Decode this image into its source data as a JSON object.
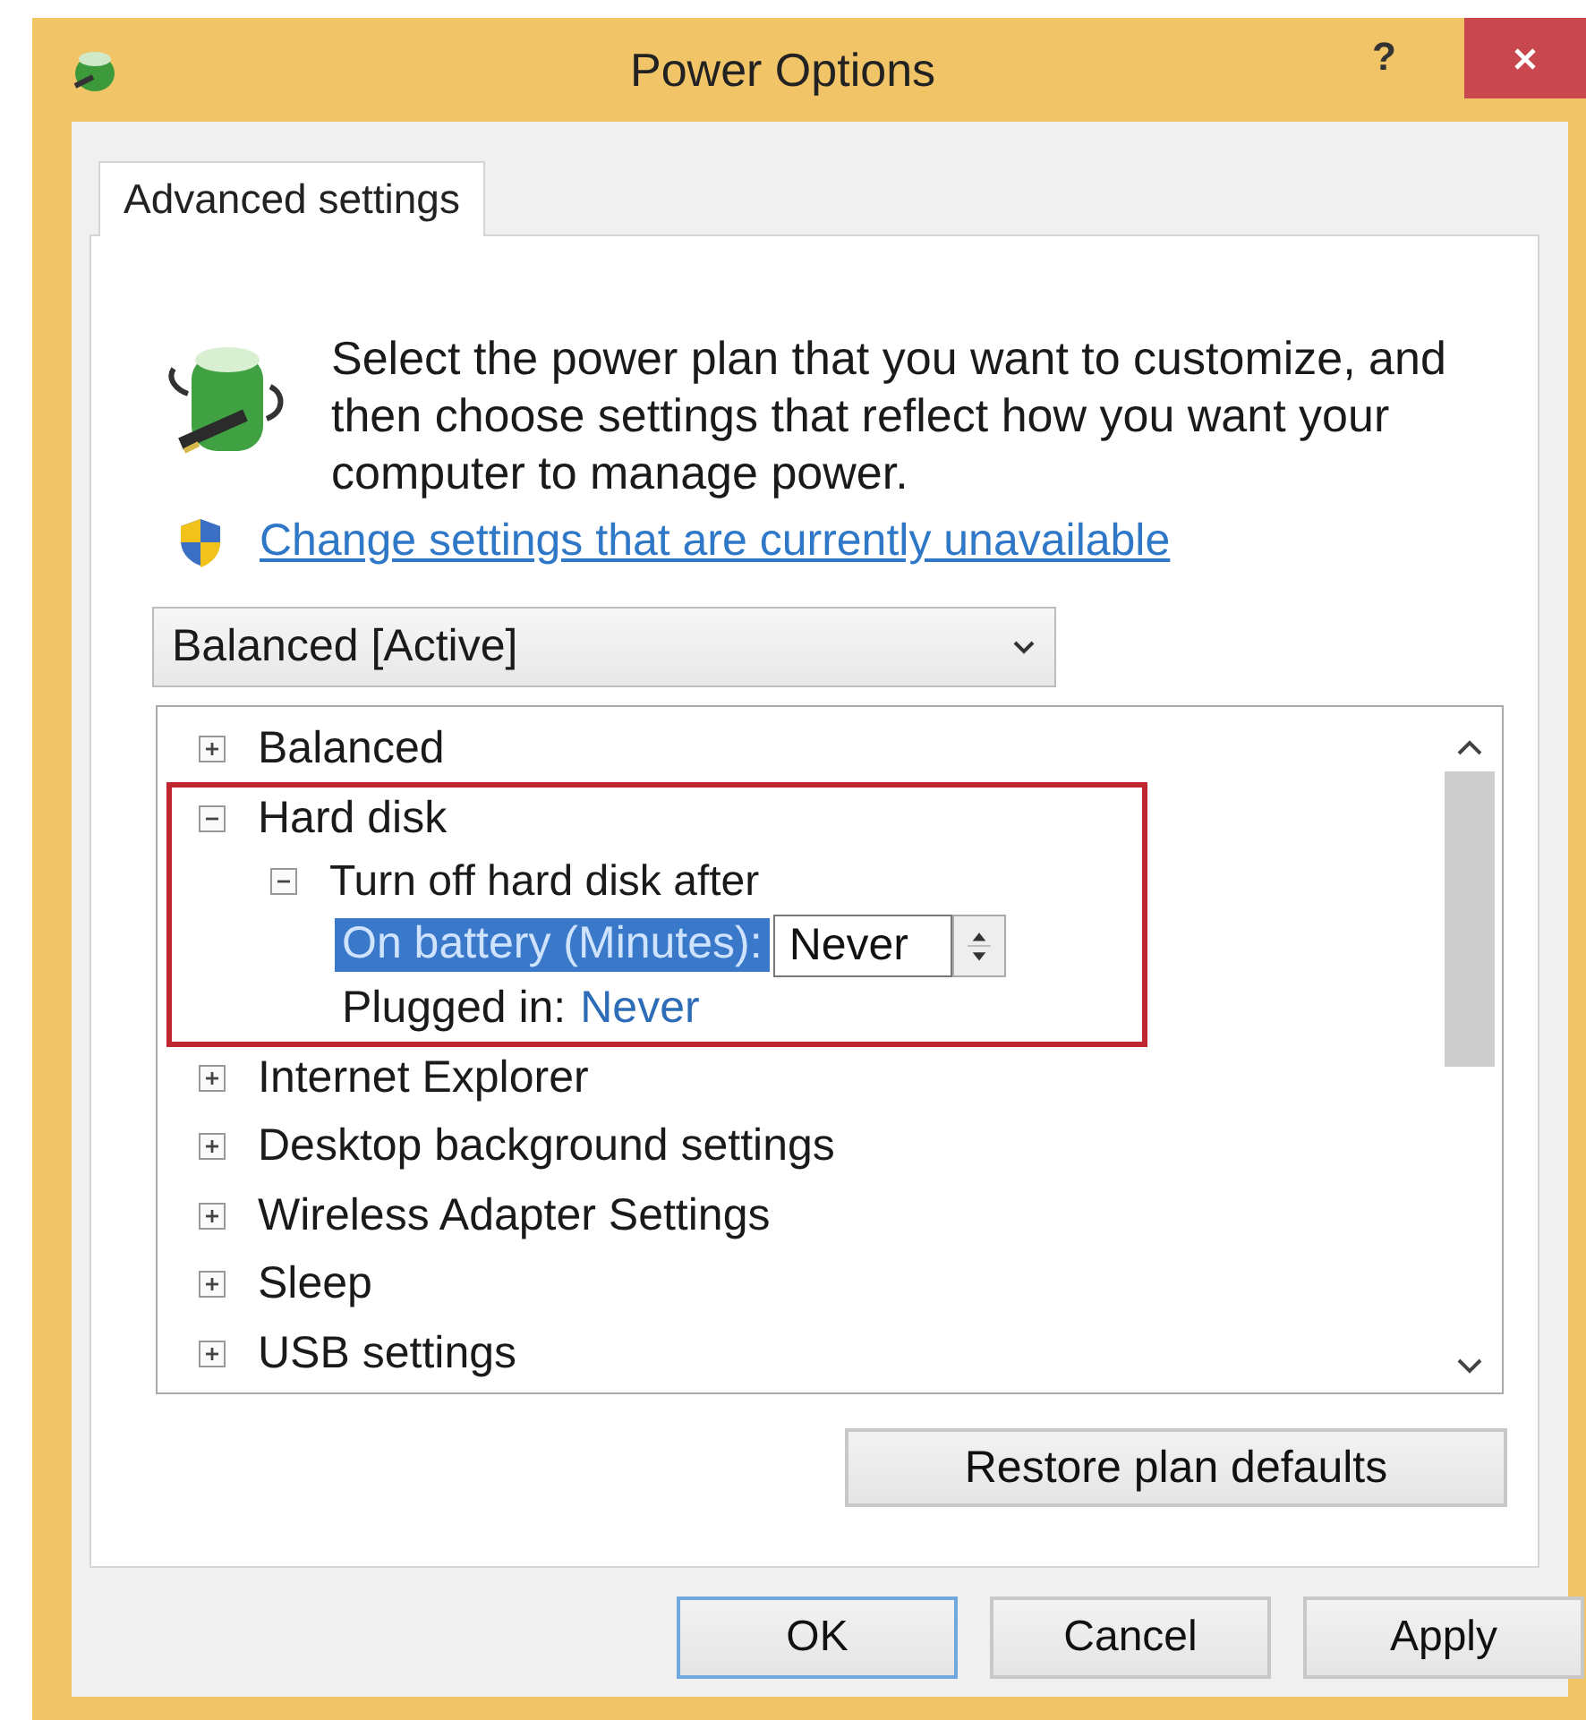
{
  "window": {
    "title": "Power Options",
    "help_button": "?"
  },
  "tabs": [
    {
      "label": "Advanced settings",
      "selected": true
    }
  ],
  "intro": "Select the power plan that you want to customize, and then choose settings that reflect how you want your computer to manage power.",
  "link": "Change settings that are currently unavailable",
  "plan_dropdown": {
    "value": "Balanced [Active]"
  },
  "settings_tree": [
    {
      "label": "Balanced",
      "expanded": false
    },
    {
      "label": "Hard disk",
      "expanded": true,
      "highlighted": true,
      "children": [
        {
          "label": "Turn off hard disk after",
          "expanded": true,
          "children": [
            {
              "kind": "spin",
              "label": "On battery (Minutes):",
              "value": "Never",
              "selected": true
            },
            {
              "kind": "value",
              "label": "Plugged in:",
              "value": "Never",
              "selected": false
            }
          ]
        }
      ]
    },
    {
      "label": "Internet Explorer",
      "expanded": false
    },
    {
      "label": "Desktop background settings",
      "expanded": false
    },
    {
      "label": "Wireless Adapter Settings",
      "expanded": false
    },
    {
      "label": "Sleep",
      "expanded": false
    },
    {
      "label": "USB settings",
      "expanded": false
    }
  ],
  "restore_button": "Restore plan defaults",
  "buttons": [
    {
      "label": "OK",
      "default": true
    },
    {
      "label": "Cancel",
      "default": false
    },
    {
      "label": "Apply",
      "default": false
    }
  ]
}
